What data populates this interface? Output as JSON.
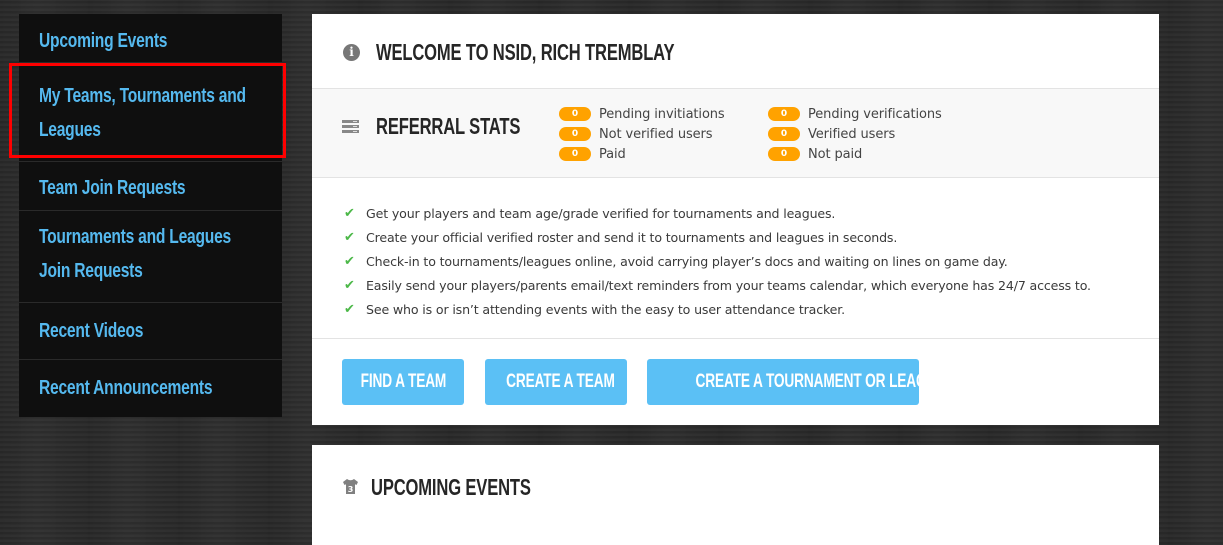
{
  "sidebar": {
    "items": [
      {
        "label": "Upcoming Events",
        "active": false
      },
      {
        "label": "My Teams, Tournaments and Leagues",
        "active": true
      },
      {
        "label": "Team Join Requests",
        "active": false
      },
      {
        "label": "Tournaments and Leagues Join Requests",
        "active": false
      },
      {
        "label": "Recent Videos",
        "active": false
      },
      {
        "label": "Recent Announcements",
        "active": false
      }
    ]
  },
  "welcome": {
    "icon": "info-icon",
    "title": "Welcome to NSID, Rich Tremblay"
  },
  "referral_stats": {
    "icon": "server-list-icon",
    "title": "Referral Stats",
    "columns": [
      [
        {
          "count": "0",
          "label": "Pending invitiations"
        },
        {
          "count": "0",
          "label": "Not verified users"
        },
        {
          "count": "0",
          "label": "Paid"
        }
      ],
      [
        {
          "count": "0",
          "label": "Pending verifications"
        },
        {
          "count": "0",
          "label": "Verified users"
        },
        {
          "count": "0",
          "label": "Not paid"
        }
      ]
    ]
  },
  "features": [
    "Get your players and team age/grade verified for tournaments and leagues.",
    "Create your official verified roster and send it to tournaments and leagues in seconds.",
    "Check-in to tournaments/leagues online, avoid carrying player’s docs and waiting on lines on game day.",
    "Easily send your players/parents email/text reminders from your teams calendar, which everyone has 24/7 access to.",
    "See who is or isn’t attending events with the easy to user attendance tracker."
  ],
  "actions": {
    "find_team": "Find a Team",
    "create_team": "Create a Team",
    "create_tournament": "Create a Tournament or League"
  },
  "upcoming": {
    "icon": "jersey-icon",
    "jersey_number": "3",
    "title": "Upcoming Events"
  },
  "colors": {
    "accent": "#5bc0f5",
    "badge": "#ffa200",
    "check": "#4cb848",
    "highlight": "#ff0000"
  }
}
